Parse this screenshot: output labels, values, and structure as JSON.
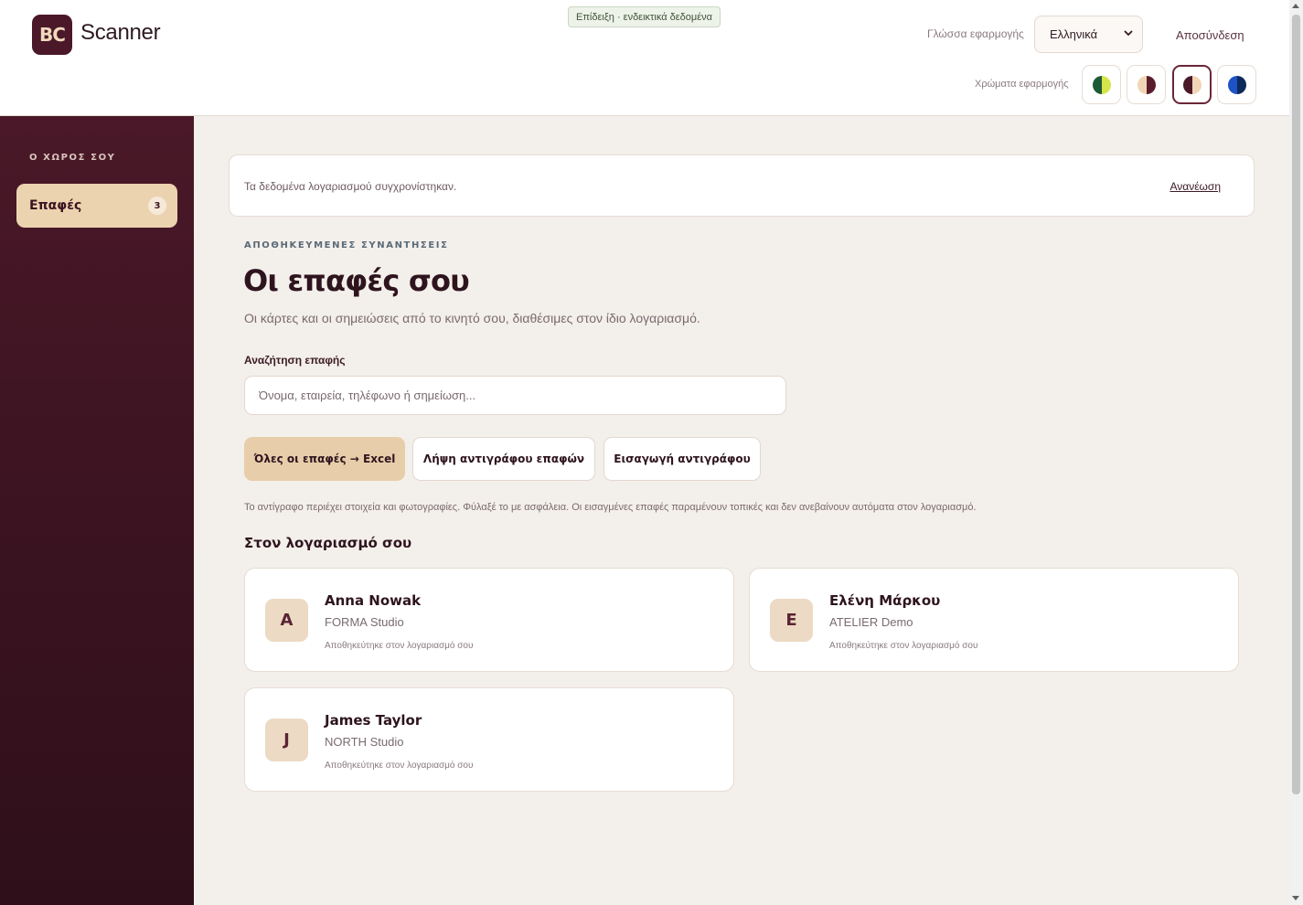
{
  "header": {
    "logo_text": "BC",
    "app_name": "Scanner",
    "demo_badge": "Επίδειξη · ενδεικτικά δεδομένα",
    "language_label": "Γλώσσα εφαρμογής",
    "language_value": "Ελληνικά",
    "logout": "Αποσύνδεση",
    "colors_label": "Χρώματα εφαρμογής",
    "themes": [
      {
        "name": "green",
        "left": "#1f5a36",
        "right": "#d6e64a"
      },
      {
        "name": "cream-burgundy",
        "left": "#f0d5b5",
        "right": "#5a1c2c"
      },
      {
        "name": "burgundy-cream",
        "left": "#4a1828",
        "right": "#f0d5b5",
        "active": true
      },
      {
        "name": "blue",
        "left": "#1e52c8",
        "right": "#0c2a5a"
      }
    ]
  },
  "sidebar": {
    "heading": "Ο ΧΩΡΟΣ ΣΟΥ",
    "items": [
      {
        "label": "Επαφές",
        "count": "3"
      }
    ]
  },
  "sync": {
    "text": "Τα δεδομένα λογαριασμού συγχρονίστηκαν.",
    "refresh": "Ανανέωση"
  },
  "main": {
    "eyebrow": "ΑΠΟΘΗΚΕΥΜΕΝΕΣ ΣΥΝΑΝΤΗΣΕΙΣ",
    "title": "Οι επαφές σου",
    "subtitle": "Οι κάρτες και οι σημειώσεις από το κινητό σου, διαθέσιμες στον ίδιο λογαριασμό.",
    "search_label": "Αναζήτηση επαφής",
    "search_placeholder": "Όνομα, εταιρεία, τηλέφωνο ή σημείωση...",
    "search_value": "",
    "buttons": {
      "export_excel": "Όλες οι επαφές → Excel",
      "download_backup": "Λήψη αντιγράφου επαφών",
      "import_backup": "Εισαγωγή αντιγράφου"
    },
    "note": "Το αντίγραφο περιέχει στοιχεία και φωτογραφίες. Φύλαξέ το με ασφάλεια. Οι εισαγμένες επαφές παραμένουν τοπικές και δεν ανεβαίνουν αυτόματα στον λογαριασμό.",
    "section_title": "Στον λογαριασμό σου",
    "contacts": [
      {
        "initial": "A",
        "name": "Anna Nowak",
        "company": "FORMA Studio",
        "status": "Αποθηκεύτηκε στον λογαριασμό σου"
      },
      {
        "initial": "E",
        "name": "Ελένη Μάρκου",
        "company": "ATELIER Demo",
        "status": "Αποθηκεύτηκε στον λογαριασμό σου"
      },
      {
        "initial": "J",
        "name": "James Taylor",
        "company": "NORTH Studio",
        "status": "Αποθηκεύτηκε στον λογαριασμό σου"
      }
    ]
  }
}
